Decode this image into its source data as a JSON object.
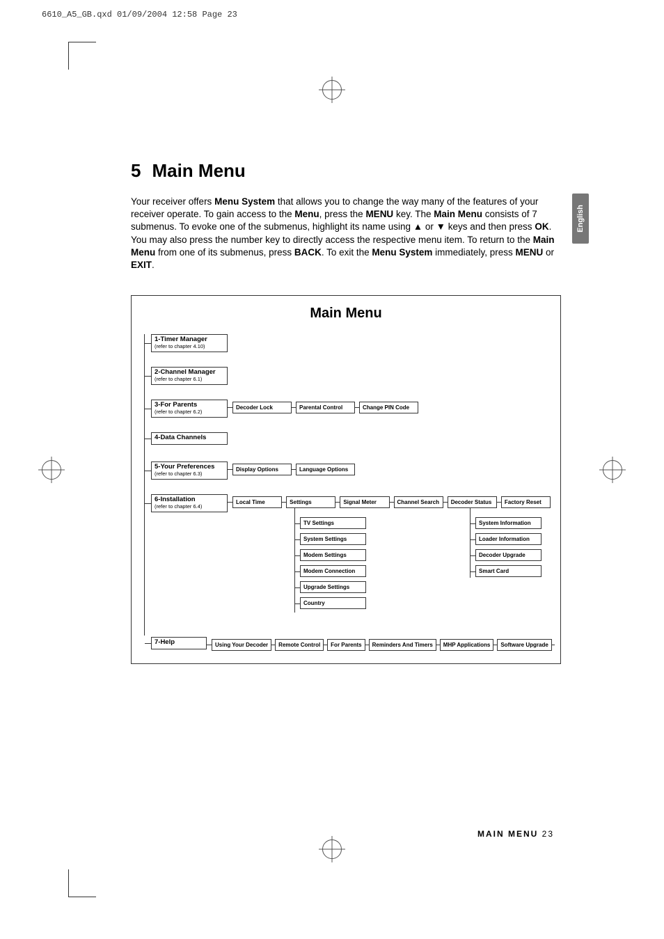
{
  "header_line": "6610_A5_GB.qxd  01/09/2004  12:58  Page 23",
  "side_tab": "English",
  "section_number": "5",
  "section_title": "Main Menu",
  "intro_parts": {
    "p1a": "Your receiver offers ",
    "p1b": "Menu System",
    "p1c": " that allows you to change the way many of the features of your receiver operate. To gain access to the ",
    "p1d": "Menu",
    "p1e": ", press the ",
    "p1f": "MENU",
    "p1g": " key. The ",
    "p1h": "Main Menu",
    "p1i": " consists of 7 submenus. To evoke one of the submenus, highlight its name using  ▲  or  ▼  keys and then press ",
    "p1j": "OK",
    "p1k": ". You may also press the number key to directly access the respective menu item. To return to the ",
    "p1l": "Main Menu",
    "p1m": " from one of its submenus, press ",
    "p1n": "BACK",
    "p1o": ". To exit the ",
    "p1p": "Menu System",
    "p1q": " immediately, press ",
    "p1r": "MENU",
    "p1s": " or ",
    "p1t": "EXIT",
    "p1u": "."
  },
  "diagram_title": "Main Menu",
  "menu": {
    "m1": {
      "title": "1-Timer Manager",
      "sub": "(refer to chapter 4.10)"
    },
    "m2": {
      "title": "2-Channel Manager",
      "sub": "(refer to chapter 6.1)"
    },
    "m3": {
      "title": "3-For Parents",
      "sub": "(refer to chapter 6.2)",
      "children": [
        "Decoder Lock",
        "Parental Control",
        "Change PIN Code"
      ]
    },
    "m4": {
      "title": "4-Data Channels"
    },
    "m5": {
      "title": "5-Your Preferences",
      "sub": "(refer to chapter 6.3)",
      "children": [
        "Display Options",
        "Language Options"
      ]
    },
    "m6": {
      "title": "6-Installation",
      "sub": "(refer to chapter 6.4)",
      "children": [
        "Local Time",
        "Settings",
        "Signal Meter",
        "Channel Search",
        "Decoder Status",
        "Factory Reset"
      ],
      "settings_sub": [
        "TV Settings",
        "System Settings",
        "Modem Settings",
        "Modem Connection",
        "Upgrade Settings",
        "Country"
      ],
      "status_sub": [
        "System Information",
        "Loader Information",
        "Decoder Upgrade",
        "Smart Card"
      ]
    },
    "m7": {
      "title": "7-Help",
      "children": [
        "Using Your Decoder",
        "Remote Control",
        "For Parents",
        "Reminders And Timers",
        "MHP Applications",
        "Software Upgrade"
      ]
    }
  },
  "footer_label": "MAIN MENU",
  "footer_page": "23"
}
